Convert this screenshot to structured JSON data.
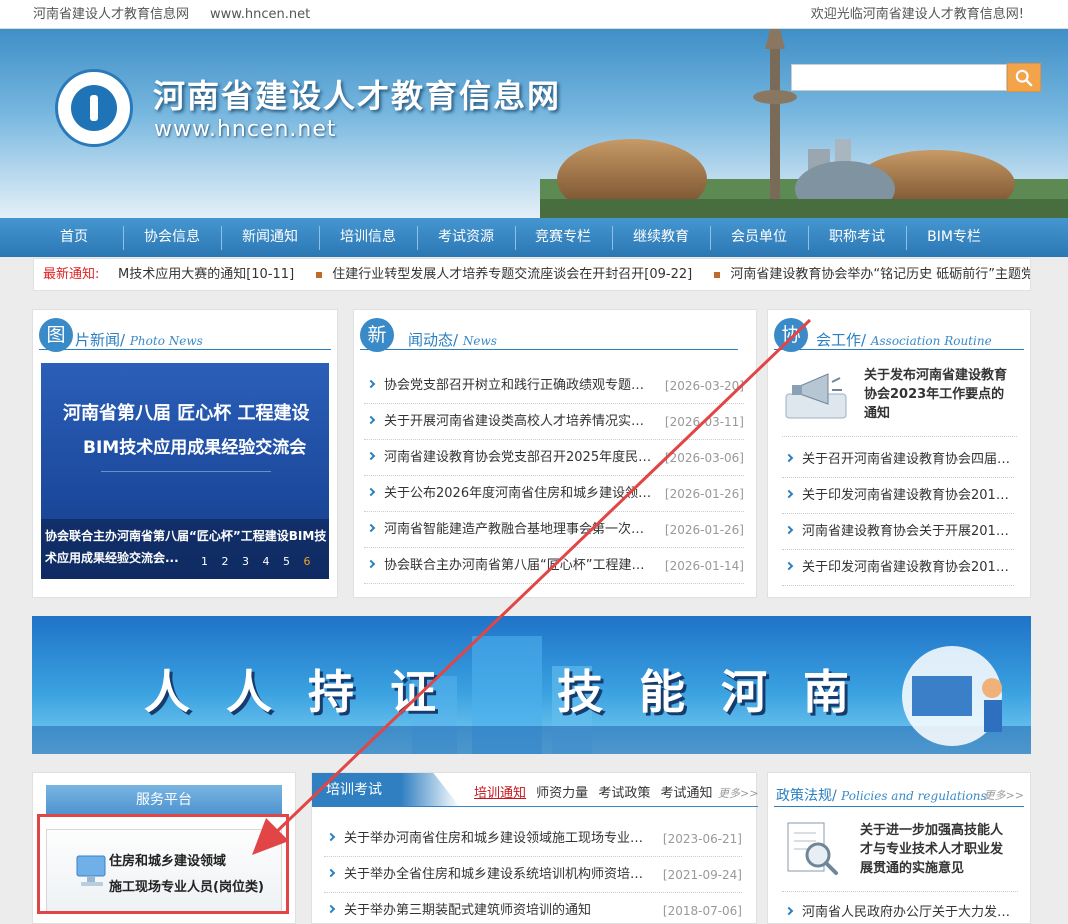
{
  "topbar": {
    "site_name": "河南省建设人才教育信息网",
    "site_url": "www.hncen.net",
    "welcome": "欢迎光临河南省建设人才教育信息网!"
  },
  "header": {
    "title": "河南省建设人才教育信息网",
    "url": "www.hncen.net",
    "search_placeholder": ""
  },
  "nav": {
    "items": [
      "首页",
      "协会信息",
      "新闻通知",
      "培训信息",
      "考试资源",
      "竞赛专栏",
      "继续教育",
      "会员单位",
      "职称考试",
      "BIM专栏"
    ]
  },
  "ticker": {
    "label": "最新通知:",
    "items": [
      "M技术应用大赛的通知[10-11]",
      "住建行业转型发展人才培养专题交流座谈会在开封召开[09-22]",
      "河南省建设教育协会举办“铭记历史 砥砺前行”主题党日活"
    ]
  },
  "photo_news": {
    "badge": "图",
    "title": "片新闻/",
    "title_en": "Photo News",
    "image_line1": "河南省第八届 匠心杯 工程建设",
    "image_line2": "BIM技术应用成果经验交流会",
    "caption": "协会联合主办河南省第八届“匠心杯”工程建设BIM技术应用成果经验交流会...",
    "pages": [
      "1",
      "2",
      "3",
      "4",
      "5",
      "6"
    ],
    "active_page": "6"
  },
  "news": {
    "badge": "新",
    "title": "闻动态/",
    "title_en": "News",
    "items": [
      {
        "title": "协会党支部召开树立和践行正确政绩观专题学习会",
        "date": "[2026-03-20]"
      },
      {
        "title": "关于开展河南省建设类高校人才培养情况实地调...",
        "date": "[2026-03-11]"
      },
      {
        "title": "河南省建设教育协会党支部召开2025年度民主...",
        "date": "[2026-03-06]"
      },
      {
        "title": "关于公布2026年度河南省住房和城乡建设领域...",
        "date": "[2026-01-26]"
      },
      {
        "title": "河南省智能建造产教融合基地理事会第一次会议...",
        "date": "[2026-01-26]"
      },
      {
        "title": "协会联合主办河南省第八届“匠心杯”工程建设...",
        "date": "[2026-01-14]"
      }
    ]
  },
  "routine": {
    "badge": "协",
    "title": "会工作/",
    "title_en": "Association Routine",
    "featured": "关于发布河南省建设教育协会2023年工作要点的通知",
    "items": [
      "关于召开河南省建设教育协会四届六...",
      "关于印发河南省建设教育协会2019...",
      "河南省建设教育协会关于开展2018...",
      "关于印发河南省建设教育协会2018..."
    ]
  },
  "promo": {
    "chars": [
      "人",
      "人",
      "持",
      "证",
      "技",
      "能",
      "河",
      "南"
    ]
  },
  "service": {
    "title": "服务平台",
    "card_line1": "住房和城乡建设领域",
    "card_line2": "施工现场专业人员(岗位类)"
  },
  "training": {
    "tab": "培训考试",
    "subtabs": [
      "培训通知",
      "师资力量",
      "考试政策",
      "考试通知"
    ],
    "more": "更多>>",
    "items": [
      {
        "title": "关于举办河南省住房和城乡建设领域施工现场专业人员...",
        "date": "[2023-06-21]"
      },
      {
        "title": "关于举办全省住房和城乡建设系统培训机构师资培训班...",
        "date": "[2021-09-24]"
      },
      {
        "title": "关于举办第三期装配式建筑师资培训的通知",
        "date": "[2018-07-06]"
      }
    ]
  },
  "policy": {
    "title": "政策法规/",
    "title_en": "Policies and regulations",
    "more": "更多>>",
    "featured": "关于进一步加强高技能人才与专业技术人才职业发展贯通的实施意见",
    "items": [
      "河南省人民政府办公厅关于大力发展..."
    ]
  },
  "colors": {
    "primary": "#2a7fc0",
    "nav": "#3486c4",
    "accent_red": "#e24545",
    "search_button": "#f3a44a"
  }
}
